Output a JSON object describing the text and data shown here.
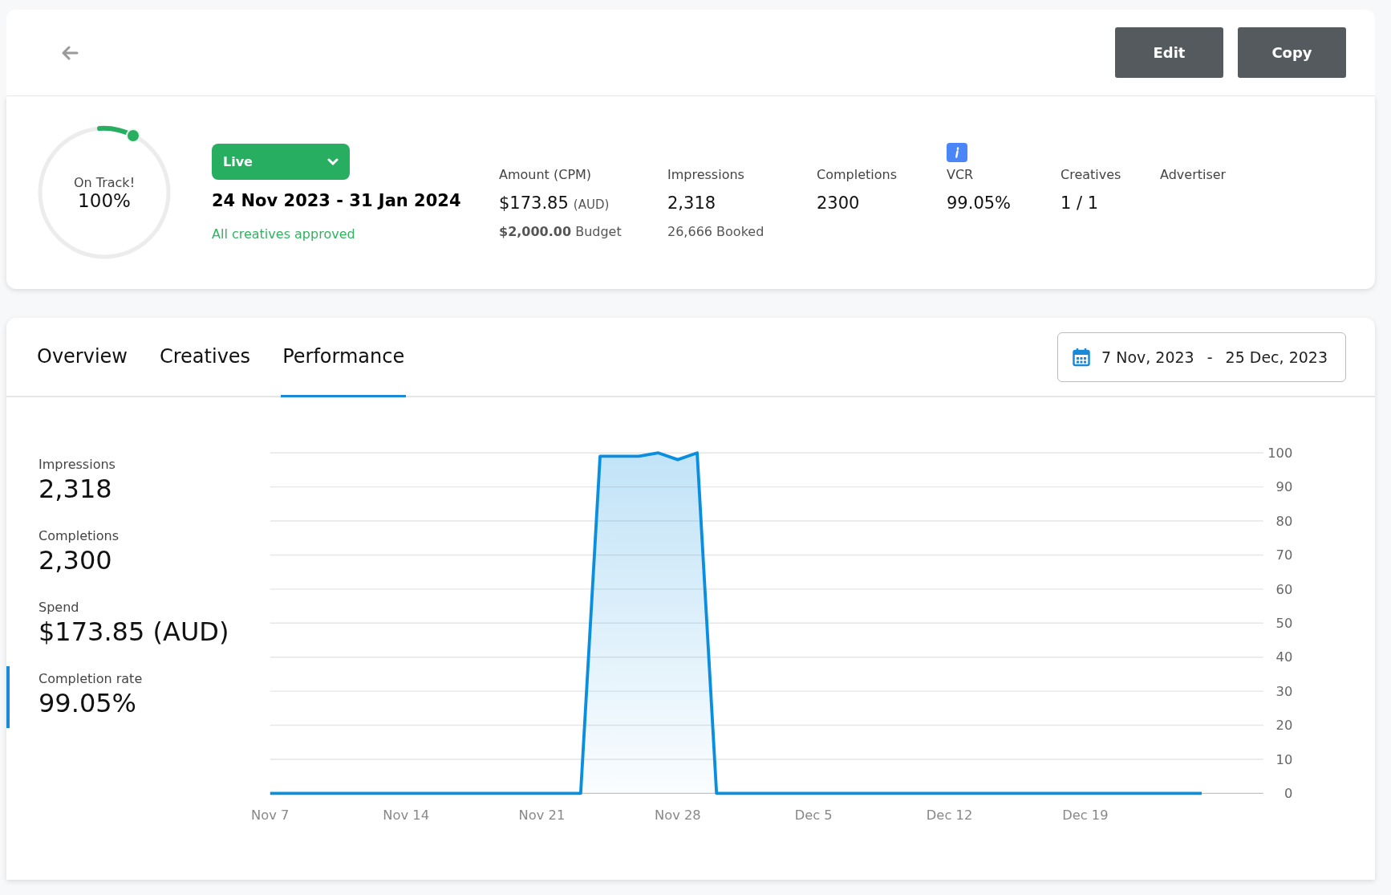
{
  "header": {
    "buttons": [
      {
        "label": "Edit"
      },
      {
        "label": "Copy"
      }
    ]
  },
  "summary": {
    "gauge": {
      "label": "On Track!",
      "value": "100%"
    },
    "status": {
      "label": "Live"
    },
    "dates": "24 Nov 2023 - 31 Jan 2024",
    "approval": "All creatives approved",
    "stats": [
      {
        "label": "Amount (CPM)",
        "value": "$173.85",
        "unit": "(AUD)",
        "sub": "**$2,000.00** Budget",
        "info": false
      },
      {
        "label": "Impressions",
        "value": "2,318",
        "sub": "26,666 Booked",
        "info": false
      },
      {
        "label": "Completions",
        "value": "2300",
        "info": false
      },
      {
        "label": "VCR",
        "value": "99.05%",
        "info": true
      },
      {
        "label": "Creatives",
        "value": "1 / 1",
        "info": false
      },
      {
        "label": "Advertiser",
        "info": false
      }
    ]
  },
  "tabs": [
    {
      "label": "Overview",
      "selected": false
    },
    {
      "label": "Creatives",
      "selected": false
    },
    {
      "label": "Performance",
      "selected": true
    }
  ],
  "date_range": {
    "start": "7 Nov, 2023",
    "separator": "-",
    "end": "25 Dec, 2023"
  },
  "metrics": [
    {
      "label": "Impressions",
      "value": "2,318",
      "selected": false
    },
    {
      "label": "Completions",
      "value": "2,300",
      "selected": false
    },
    {
      "label": "Spend",
      "value": "$173.85 (AUD)",
      "selected": false
    },
    {
      "label": "Completion rate",
      "value": "99.05%",
      "selected": true
    }
  ],
  "chart_data": {
    "type": "area",
    "categories": [
      "Nov 7",
      null,
      null,
      null,
      null,
      null,
      null,
      "Nov 14",
      null,
      null,
      null,
      null,
      null,
      null,
      "Nov 21",
      null,
      null,
      null,
      null,
      null,
      null,
      "Nov 28",
      null,
      null,
      null,
      null,
      null,
      null,
      "Dec 5",
      null,
      null,
      null,
      null,
      null,
      null,
      "Dec 12",
      null,
      null,
      null,
      null,
      null,
      null,
      "Dec 19",
      null,
      null,
      null,
      null,
      null,
      null
    ],
    "grid": true,
    "series": [
      {
        "color": "#0a8fe0",
        "values": [
          0,
          0,
          0,
          0,
          0,
          0,
          0,
          0,
          0,
          0,
          0,
          0,
          0,
          0,
          0,
          0,
          0,
          99,
          99,
          99,
          100,
          98,
          100,
          0,
          0,
          0,
          0,
          0,
          0,
          0,
          0,
          0,
          0,
          0,
          0,
          0,
          0,
          0,
          0,
          0,
          0,
          0,
          0,
          0,
          0,
          0,
          0,
          0,
          0
        ]
      }
    ],
    "ylim": [
      0,
      100
    ],
    "yticks": [
      0,
      10,
      20,
      30,
      40,
      50,
      60,
      70,
      80,
      90,
      100
    ]
  }
}
